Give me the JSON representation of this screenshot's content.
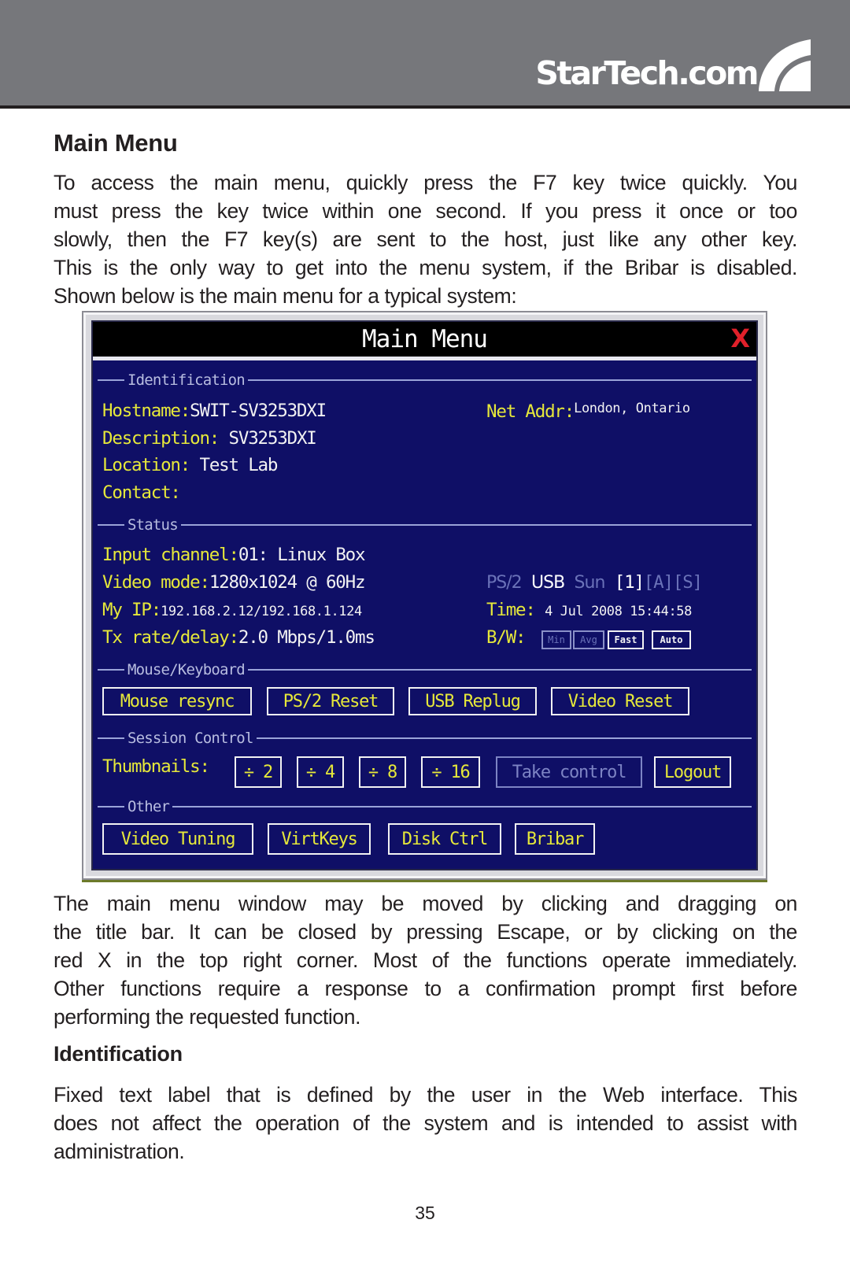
{
  "header": {
    "brand": "StarTech.com",
    "brand_bar_color": "#76777b"
  },
  "section_title": "Main Menu",
  "intro_lines": [
    "To access the main menu, quickly press the F7 key twice quickly. You",
    "must press the key twice within one second. If you press it once or too",
    "slowly, then the F7 key(s) are sent to the host, just like any other key.",
    "This is the only way to get into the menu system, if the Bribar is disabled.",
    "Shown below is the main menu for a typical system:"
  ],
  "kvm_menu": {
    "title": "Main Menu",
    "close_label": "X",
    "colors": {
      "background": "#0f0f66",
      "label": "#e6e83a",
      "value": "#f2f2f2",
      "close": "#e0202a"
    },
    "identification": {
      "section_label": "Identification",
      "hostname_label": "Hostname:",
      "hostname_value": "SWIT-SV3253DXI",
      "net_addr_label": "Net Addr:",
      "net_addr_value": "London, Ontario",
      "description_label": "Description:",
      "description_value": "SV3253DXI",
      "location_label": "Location:",
      "location_value": "Test Lab",
      "contact_label": "Contact:",
      "contact_value": ""
    },
    "status": {
      "section_label": "Status",
      "input_channel_label": "Input channel:",
      "input_channel_value": "01: Linux Box",
      "video_mode_label": "Video mode:",
      "video_mode_value": "1280x1024 @ 60Hz",
      "my_ip_label": "My IP:",
      "my_ip_value": "192.168.2.12/192.168.1.124",
      "tx_label": "Tx rate/delay:",
      "tx_value": "2.0 Mbps/1.0ms",
      "kbd_types": [
        {
          "label": "PS/2",
          "active": false
        },
        {
          "label": "USB",
          "active": true
        },
        {
          "label": "Sun",
          "active": false
        }
      ],
      "indicators": [
        {
          "label": "[1]",
          "active": true
        },
        {
          "label": "[A]",
          "active": false
        },
        {
          "label": "[S]",
          "active": false
        }
      ],
      "time_label": "Time:",
      "time_value": "4 Jul 2008 15:44:58",
      "bw_label": "B/W:",
      "bw_options": [
        {
          "label": "Min",
          "active": false
        },
        {
          "label": "Avg",
          "active": false
        },
        {
          "label": "Fast",
          "active": true
        },
        {
          "label": "Auto",
          "active": true
        }
      ]
    },
    "mouse_keyboard": {
      "section_label": "Mouse/Keyboard",
      "buttons": [
        "Mouse resync",
        "PS/2 Reset",
        "USB Replug",
        "Video Reset"
      ]
    },
    "session_control": {
      "section_label": "Session Control",
      "thumbnails_label": "Thumbnails:",
      "thumbnail_buttons": [
        "÷ 2",
        "÷ 4",
        "÷ 8",
        "÷ 16"
      ],
      "take_control_label": "Take control",
      "take_control_enabled": false,
      "logout_label": "Logout"
    },
    "other": {
      "section_label": "Other",
      "buttons": [
        "Video Tuning",
        "VirtKeys",
        "Disk Ctrl",
        "Bribar"
      ]
    }
  },
  "after_lines": [
    "The main menu window may be moved by clicking and dragging on",
    "the title bar. It can be closed by pressing Escape, or by clicking on the",
    "red X in the top right corner. Most of the functions operate immediately.",
    "Other functions require a response to a confirmation prompt first before",
    "performing the requested function."
  ],
  "subsection_title": "Identification",
  "identification_lines": [
    "Fixed text label that is defined by the user in the Web interface. This",
    "does not affect the operation of the system and is intended to assist with",
    "administration."
  ],
  "page_number": "35"
}
